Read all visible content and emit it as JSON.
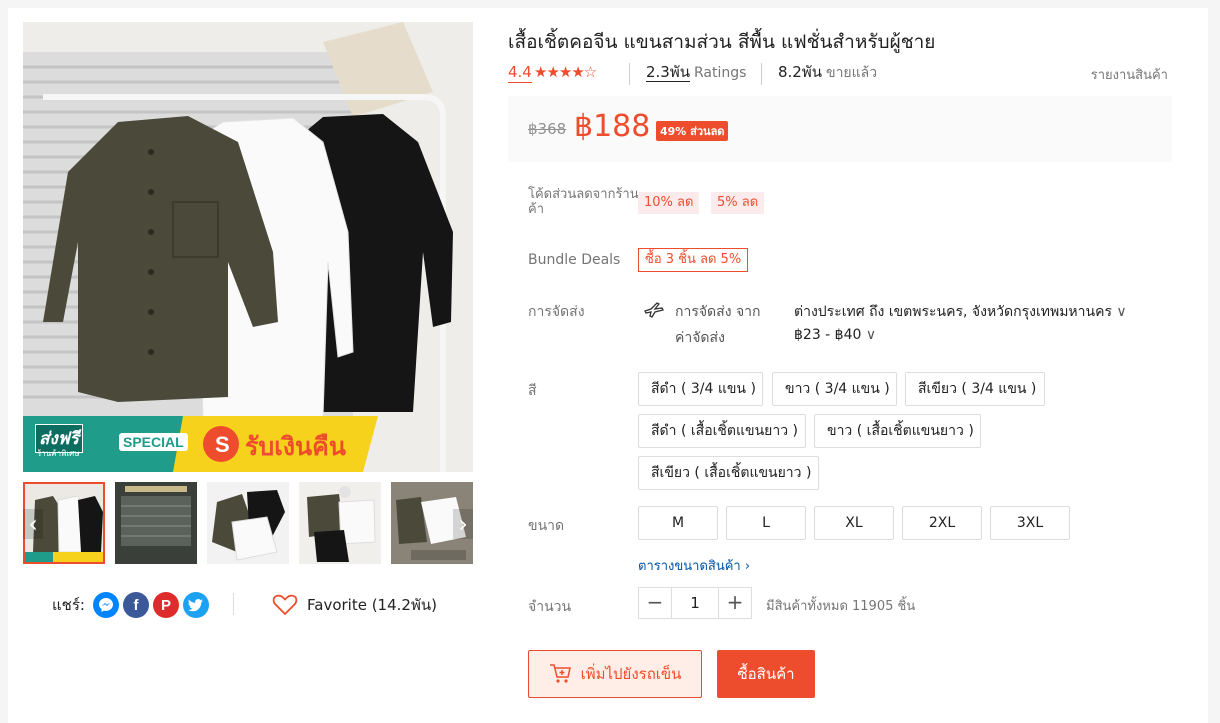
{
  "product": {
    "title": "เสื้อเชิ้ตคอจีน แขนสามส่วน สีพื้น แฟชั่นสำหรับผู้ชาย",
    "rating": "4.4",
    "stars": "★★★★☆",
    "ratings_count": "2.3พัน",
    "ratings_label": "Ratings",
    "sold_count": "8.2พัน",
    "sold_label": "ขายแล้ว",
    "report_label": "รายงานสินค้า"
  },
  "price": {
    "original": "฿368",
    "current": "฿188",
    "discount_badge": "49% ส่วนลด"
  },
  "vouchers": {
    "label": "โค้ดส่วนลดจากร้านค้า",
    "items": [
      "10% ลด",
      "5% ลด"
    ]
  },
  "bundle": {
    "label": "Bundle Deals",
    "deal": "ซื้อ 3 ชิ้น ลด 5%"
  },
  "shipping": {
    "label": "การจัดส่ง",
    "from_label": "การจัดส่ง จาก",
    "from_value": "ต่างประเทศ ถึง เขตพระนคร, จังหวัดกรุงเทพมหานคร",
    "fee_label": "ค่าจัดส่ง",
    "fee_value": "฿23 - ฿40"
  },
  "color": {
    "label": "สี",
    "options": [
      "สีดำ ( 3/4 แขน )",
      "ขาว ( 3/4 แขน )",
      "สีเขียว ( 3/4 แขน )",
      "สีดำ ( เสื้อเชิ้ตแขนยาว )",
      "ขาว ( เสื้อเชิ้ตแขนยาว )",
      "สีเขียว ( เสื้อเชิ้ตแขนยาว )"
    ]
  },
  "size": {
    "label": "ขนาด",
    "options": [
      "M",
      "L",
      "XL",
      "2XL",
      "3XL"
    ],
    "chart_link": "ตารางขนาดสินค้า"
  },
  "quantity": {
    "label": "จำนวน",
    "value": "1",
    "stock": "มีสินค้าทั้งหมด 11905 ชิ้น"
  },
  "actions": {
    "add_to_cart": "เพิ่มไปยังรถเข็น",
    "buy_now": "ซื้อสินค้า"
  },
  "banner": {
    "free_ship": "ส่งฟรี",
    "free_ship_sub": "ร้านค้าพิเศษ",
    "special": "SPECIAL",
    "cashback": "รับเงินคืน"
  },
  "share": {
    "label": "แชร์:",
    "icons": [
      "messenger-icon",
      "facebook-icon",
      "pinterest-icon",
      "twitter-icon"
    ]
  },
  "favorite": {
    "label": "Favorite (14.2พัน)"
  },
  "colors": {
    "accent": "#ee4d2d",
    "shirt_green": "#4b4a3a",
    "shirt_black": "#151515",
    "banner_teal": "#1f9c8a",
    "banner_yellow": "#f7d21d"
  }
}
